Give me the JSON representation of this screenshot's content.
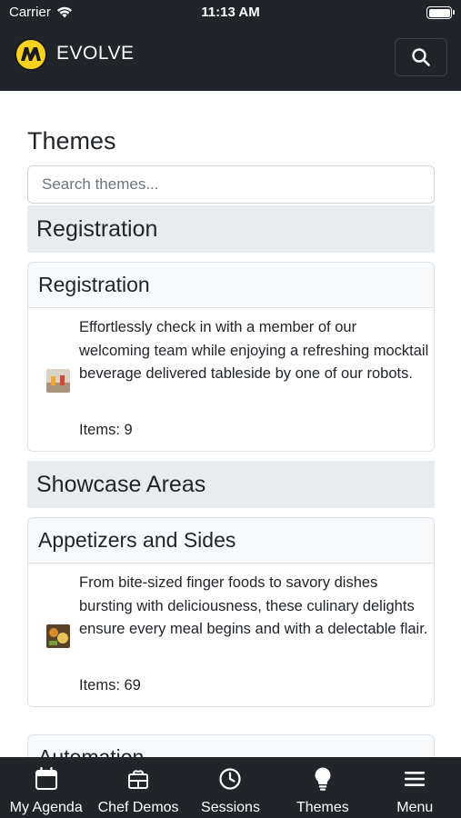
{
  "status_bar": {
    "carrier": "Carrier",
    "time": "11:13 AM"
  },
  "navbar": {
    "brand": "EVOLVE",
    "logo_icon": "evolve-logo",
    "search_icon": "search-icon"
  },
  "page": {
    "title": "Themes",
    "search_placeholder": "Search themes..."
  },
  "sections": [
    {
      "header": "Registration",
      "cards": [
        {
          "title": "Registration",
          "description": "Effortlessly check in with a member of our welcoming team while enjoying a refreshing mocktail beverage delivered tableside by one of our robots.",
          "items": "Items: 9"
        }
      ]
    },
    {
      "header": "Showcase Areas",
      "cards": [
        {
          "title": "Appetizers and Sides",
          "description": "From bite-sized finger foods to savory dishes bursting with deliciousness, these culinary delights ensure every meal begins and with a delectable flair.",
          "items": "Items: 69"
        },
        {
          "title": "Automation"
        }
      ]
    }
  ],
  "tabbar": [
    {
      "label": "My Agenda",
      "icon": "calendar-icon"
    },
    {
      "label": "Chef Demos",
      "icon": "chef-hat-icon"
    },
    {
      "label": "Sessions",
      "icon": "clock-icon"
    },
    {
      "label": "Themes",
      "icon": "lightbulb-icon"
    },
    {
      "label": "Menu",
      "icon": "hamburger-menu-icon"
    }
  ],
  "colors": {
    "navbar_bg": "#212529",
    "section_bg": "#e9ecef",
    "card_header_bg": "#f8f9fa",
    "logo_yellow": "#f7d21f"
  }
}
